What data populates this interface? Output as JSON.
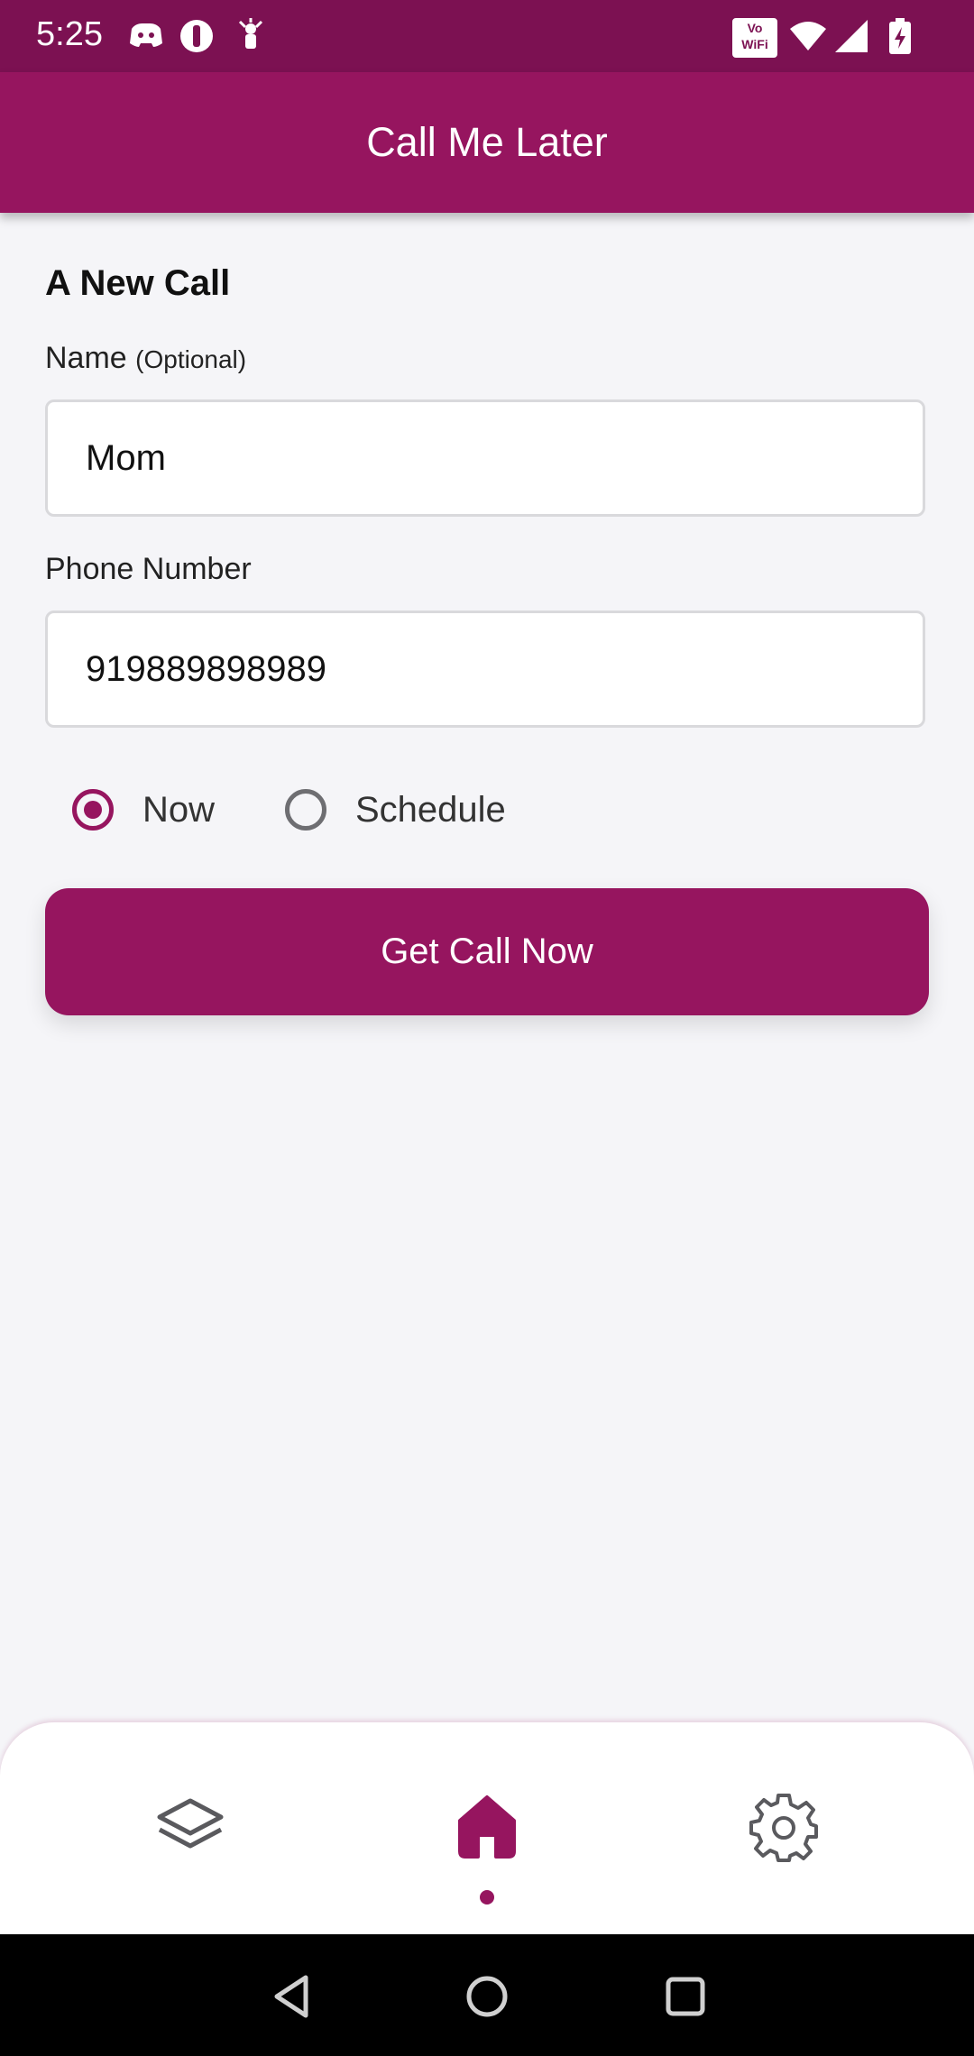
{
  "status_bar": {
    "time": "5:25",
    "left_icons": [
      "discord-icon",
      "app-icon",
      "notification-icon"
    ],
    "right_icons": [
      "vowifi-icon",
      "wifi-icon",
      "signal-icon",
      "battery-charging-icon"
    ],
    "vowifi_text_top": "Vo",
    "vowifi_text_bottom": "WiFi"
  },
  "app_bar": {
    "title": "Call Me Later"
  },
  "form": {
    "section_title": "A New Call",
    "name_label": "Name",
    "name_optional": "(Optional)",
    "name_value": "Mom",
    "phone_label": "Phone Number",
    "phone_value": "919889898989",
    "radio_now": "Now",
    "radio_schedule": "Schedule",
    "selected": "Now",
    "submit_label": "Get Call Now"
  },
  "bottom_nav": {
    "items": [
      "layers-icon",
      "home-icon",
      "gear-icon"
    ],
    "active": "home-icon"
  },
  "system_nav": [
    "back-icon",
    "home-circle-icon",
    "recents-icon"
  ],
  "colors": {
    "primary": "#96155f",
    "status_bar": "#7c1152",
    "background": "#f5f5f8"
  }
}
